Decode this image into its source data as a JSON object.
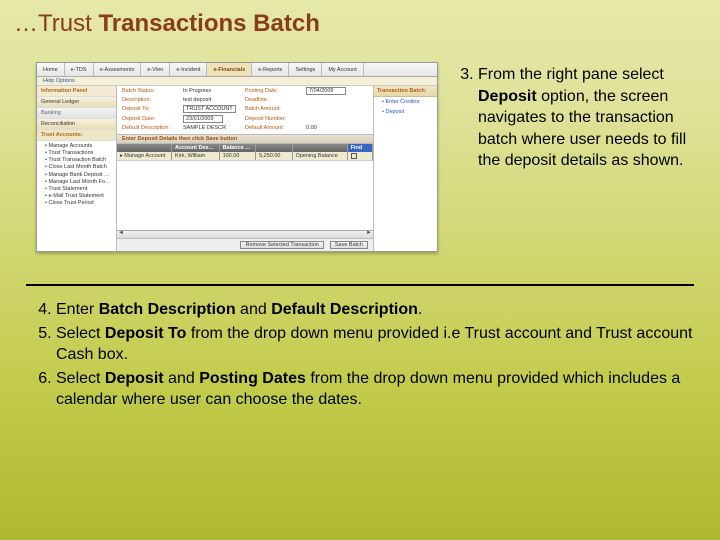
{
  "title_prefix": "…Trust ",
  "title_bold": "Transactions Batch",
  "shot": {
    "tabs": [
      "Home",
      "e-TDS",
      "e-Assesments",
      "e-Vlen",
      "e-Incident",
      "e-Financials",
      "e-Reports",
      "Settings",
      "My Account"
    ],
    "tab_selected_index": 5,
    "subbar": "Help Options",
    "left": {
      "info_panel": "Information Panel",
      "gl": "General Ledger",
      "banking": "Banking",
      "reconciliation": "Reconciliation",
      "trust_hdr": "Trust Accounts:",
      "links": [
        "Manage Accounts",
        "Trust Transactions",
        "Trust Transaction Batch",
        "Close Last Month Batch",
        "Manage Bank Deposit Forms",
        "Manage Last Month Forms",
        "Trust Statement",
        "e-Mail Trust Statement",
        "Close Trust Period"
      ]
    },
    "form": {
      "batch_status_l": "Batch Status:",
      "batch_status_v": "In Progress",
      "posting_date_l": "Posting Date:",
      "posting_date_v": "7/04/2009",
      "description_l": "Description:",
      "description_v": "test deposit",
      "deadline_l": "Deadline:",
      "deposit_to_l": "Deposit To:",
      "deposit_to_v": "TRUST ACCOUNT",
      "batch_amount_l": "Batch Amount:",
      "deposit_date_l": "Deposit Date:",
      "deposit_date_v": "23/01/2009",
      "deposit_number_l": "Deposit Number:",
      "deposit_number_v": "",
      "default_desc_l": "Default Description:",
      "default_desc_v": "SAMPLE DESCR",
      "default_amount_l": "Default Amount:",
      "default_amount_v": "0.00"
    },
    "grid": {
      "title": "Enter Deposit Details then click Save button",
      "cols": [
        "",
        "Account Description",
        "Balance Amount",
        "",
        "",
        "Find"
      ],
      "rows": [
        [
          "Manage Account",
          "Kirk, William",
          "100.00",
          "5,250.00",
          "Opening Balance",
          ""
        ]
      ]
    },
    "footer": {
      "btn1": "Remove Selected Transaction",
      "btn2": "Save Batch"
    },
    "right": {
      "hdr": "Transaction Batch:",
      "links": [
        "Enter Creditor",
        "Deposit"
      ]
    }
  },
  "step3_pre": "From the right pane select ",
  "step3_bold": "Deposit",
  "step3_post": " option, the screen navigates to the transaction batch where user needs to fill the deposit details as shown.",
  "step4_pre": "Enter ",
  "step4_bold1": "Batch Description",
  "step4_mid": " and ",
  "step4_bold2": "Default Description",
  "step4_end": ".",
  "step5_pre": "Select ",
  "step5_bold": "Deposit To",
  "step5_post": " from the drop down menu provided i.e Trust account and Trust account Cash box.",
  "step6_pre": "Select ",
  "step6_bold1": "Deposit",
  "step6_mid": " and ",
  "step6_bold2": "Posting Dates",
  "step6_post": " from the drop down menu provided which includes a calendar where user can choose the dates."
}
